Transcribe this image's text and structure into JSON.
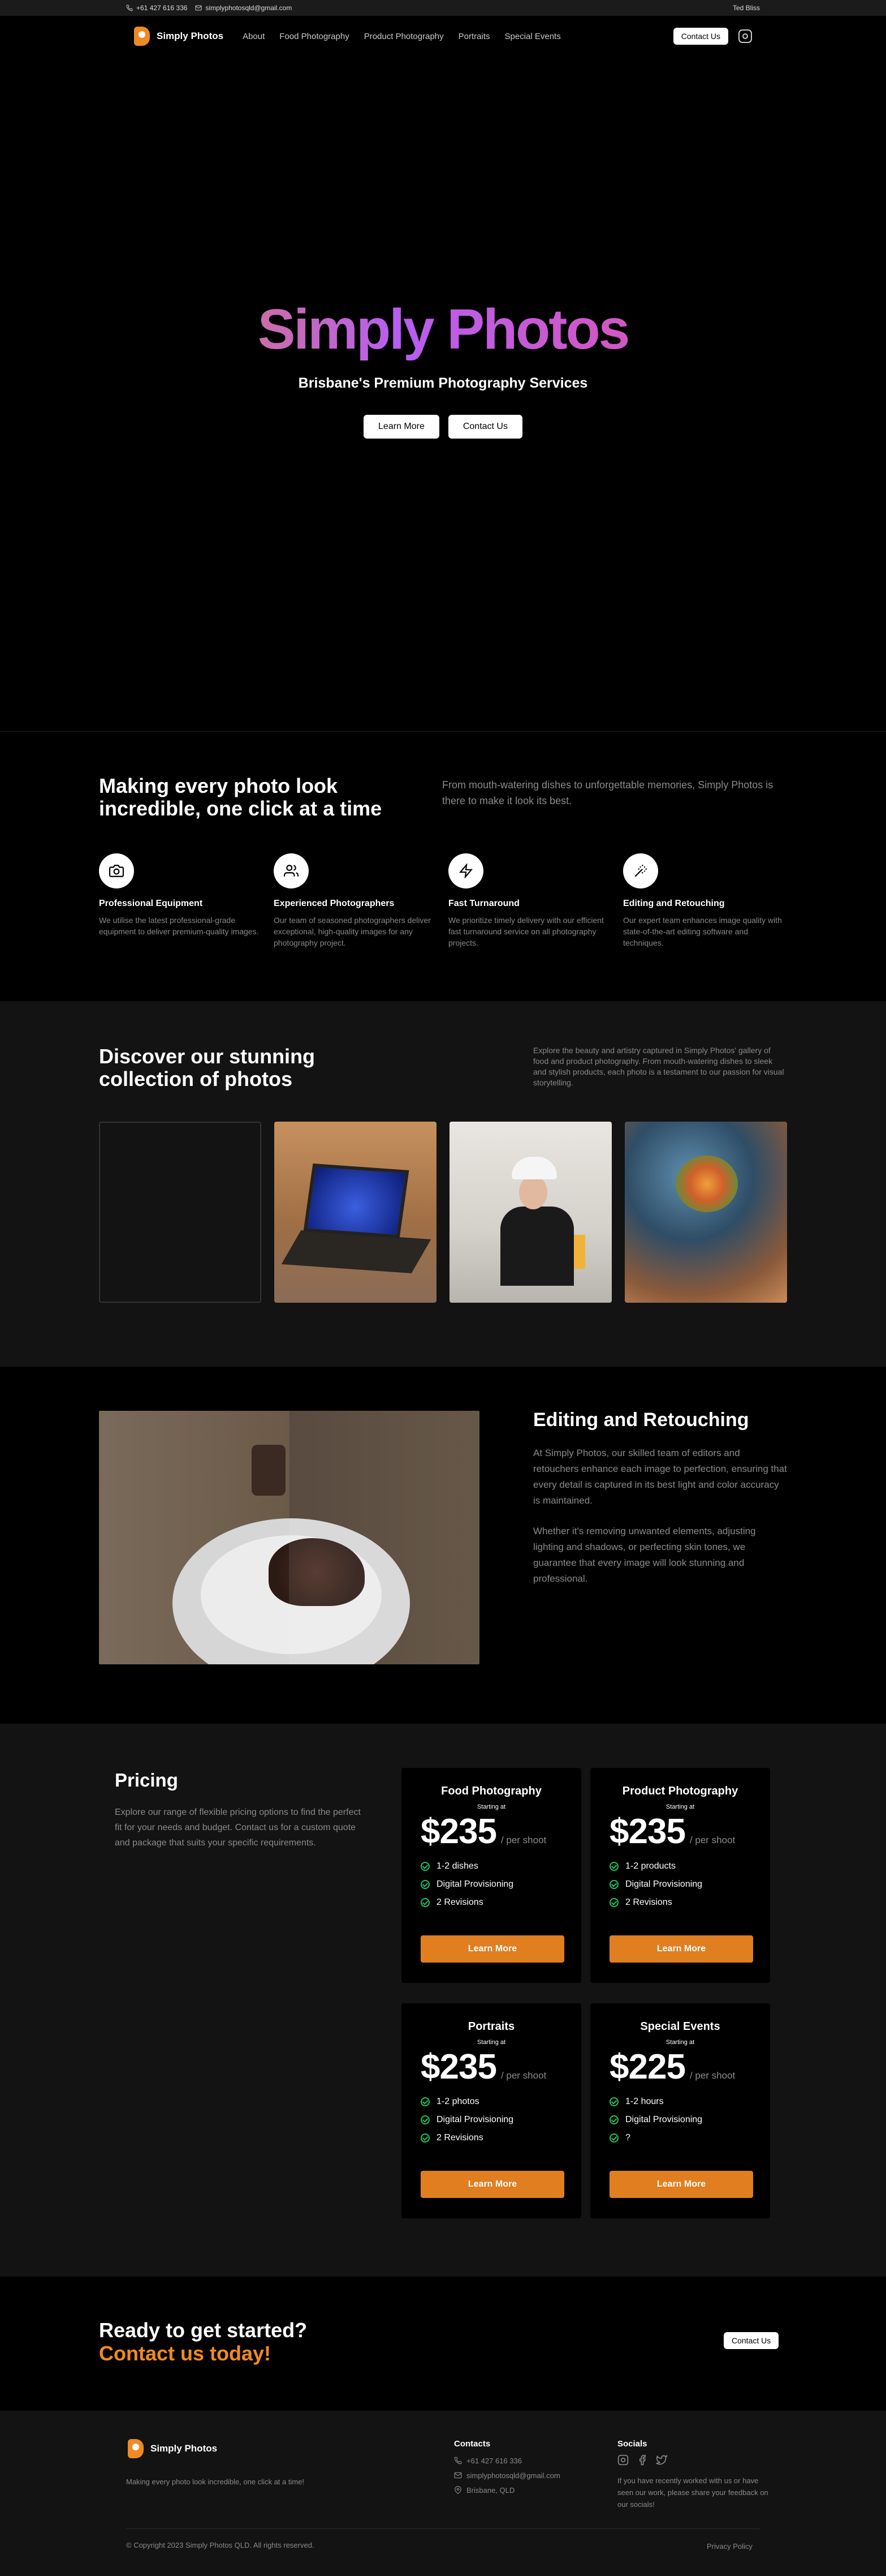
{
  "topbar": {
    "phone": "+61 427 616 336",
    "email": "simplyphotosqld@gmail.com",
    "user": "Ted Bliss"
  },
  "nav": {
    "brand": "Simply Photos",
    "links": [
      "About",
      "Food Photography",
      "Product Photography",
      "Portraits",
      "Special Events"
    ],
    "contact": "Contact Us",
    "instagram_icon": "instagram-icon"
  },
  "hero": {
    "title": "Simply Photos",
    "subtitle": "Brisbane's Premium Photography Services",
    "learn_more": "Learn More",
    "contact": "Contact Us"
  },
  "features": {
    "title": "Making every photo look incredible, one click at a time",
    "description": "From mouth-watering dishes to unforgettable memories, Simply Photos is there to make it look its best.",
    "items": [
      {
        "icon": "camera-icon",
        "title": "Professional Equipment",
        "text": "We utilise the latest professional-grade equipment to deliver premium-quality images."
      },
      {
        "icon": "users-icon",
        "title": "Experienced Photographers",
        "text": "Our team of seasoned photographers deliver exceptional, high-quality images for any photography project."
      },
      {
        "icon": "lightning-icon",
        "title": "Fast Turnaround",
        "text": "We prioritize timely delivery with our efficient fast turnaround service on all photography projects."
      },
      {
        "icon": "wand-icon",
        "title": "Editing and Retouching",
        "text": "Our expert team enhances image quality with state-of-the-art editing software and techniques."
      }
    ]
  },
  "gallery": {
    "title": "Discover our stunning collection of photos",
    "description": "Explore the beauty and artistry captured in Simply Photos' gallery of food and product photography. From mouth-watering dishes to sleek and stylish products, each photo is a testament to our passion for visual storytelling."
  },
  "editing": {
    "title": "Editing and Retouching",
    "p1": "At Simply Photos, our skilled team of editors and retouchers enhance each image to perfection, ensuring that every detail is captured in its best light and color accuracy is maintained.",
    "p2": "Whether it's removing unwanted elements, adjusting lighting and shadows, or perfecting skin tones, we guarantee that every image will look stunning and professional."
  },
  "pricing": {
    "title": "Pricing",
    "description": "Explore our range of flexible pricing options to find the perfect fit for your needs and budget. Contact us for a custom quote and package that suits your specific requirements.",
    "cards": [
      {
        "title": "Food Photography",
        "starting": "Starting at",
        "price": "$235",
        "per": "/ per shoot",
        "features": [
          "1-2 dishes",
          "Digital Provisioning",
          "2 Revisions"
        ],
        "button": "Learn More"
      },
      {
        "title": "Product Photography",
        "starting": "Starting at",
        "price": "$235",
        "per": "/ per shoot",
        "features": [
          "1-2 products",
          "Digital Provisioning",
          "2 Revisions"
        ],
        "button": "Learn More"
      },
      {
        "title": "Portraits",
        "starting": "Starting at",
        "price": "$235",
        "per": "/ per shoot",
        "features": [
          "1-2 photos",
          "Digital Provisioning",
          "2 Revisions"
        ],
        "button": "Learn More"
      },
      {
        "title": "Special Events",
        "starting": "Starting at",
        "price": "$225",
        "per": "/ per shoot",
        "features": [
          "1-2 hours",
          "Digital Provisioning",
          "?"
        ],
        "button": "Learn More"
      }
    ]
  },
  "cta": {
    "line1": "Ready to get started?",
    "line2": "Contact us today!",
    "button": "Contact Us"
  },
  "footer": {
    "brand": "Simply Photos",
    "tagline": "Making every photo look incredible, one click at a time!",
    "contacts_heading": "Contacts",
    "phone": "+61 427 616 336",
    "email": "simplyphotosqld@gmail.com",
    "location": "Brisbane, QLD",
    "socials_heading": "Socials",
    "socials_note": "If you have recently worked with us or have seen our work, please share your feedback on our socials!",
    "copyright": "© Copyright 2023 Simply Photos QLD. All rights reserved.",
    "privacy": "Privacy Policy"
  },
  "colors": {
    "accent": "#e07e20",
    "check": "#22c35e",
    "panel": "#131313"
  }
}
